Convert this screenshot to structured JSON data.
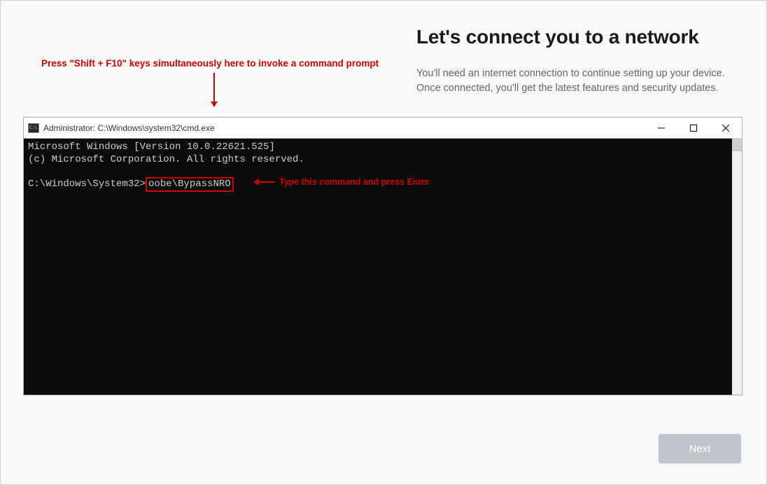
{
  "oobe": {
    "title": "Let's connect you to a network",
    "subtitle": "You'll need an internet connection to continue setting up your device. Once connected, you'll get the latest features and security updates.",
    "next_label": "Next"
  },
  "annotations": {
    "top": "Press \"Shift + F10\" keys simultaneously here to invoke a command prompt",
    "inline": "Type this command and press Enter"
  },
  "cmd": {
    "title": "Administrator: C:\\Windows\\system32\\cmd.exe",
    "line1": "Microsoft Windows [Version 10.0.22621.525]",
    "line2": "(c) Microsoft Corporation. All rights reserved.",
    "prompt": "C:\\Windows\\System32>",
    "command": "oobe\\BypassNRO"
  }
}
